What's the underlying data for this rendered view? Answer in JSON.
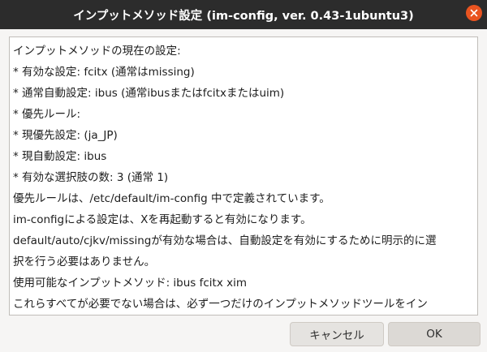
{
  "window": {
    "title": "インプットメソッド設定 (im-config, ver. 0.43-1ubuntu3)"
  },
  "message": {
    "lines": [
      "インプットメソッドの現在の設定:",
      " * 有効な設定: fcitx (通常はmissing)",
      " * 通常自動設定: ibus (通常ibusまたはfcitxまたはuim)",
      " * 優先ルール:",
      " * 現優先設定:  (ja_JP)",
      " * 現自動設定: ibus",
      " * 有効な選択肢の数: 3 (通常 1)",
      "優先ルールは、/etc/default/im-config 中で定義されています。",
      "im-configによる設定は、Xを再起動すると有効になります。",
      "default/auto/cjkv/missingが有効な場合は、自動設定を有効にするために明示的に選",
      "択を行う必要はありません。",
      "  使用可能なインプットメソッド: ibus fcitx xim",
      "これらすべてが必要でない場合は、必ず一つだけのインプットメソッドツールをイン"
    ]
  },
  "buttons": {
    "cancel_label": "キャンセル",
    "ok_label": "OK"
  },
  "icons": {
    "close": "close-icon"
  },
  "colors": {
    "titlebar": "#2c2c2c",
    "close_button": "#e95420",
    "window_bg": "#f6f5f4",
    "content_bg": "#ffffff"
  }
}
